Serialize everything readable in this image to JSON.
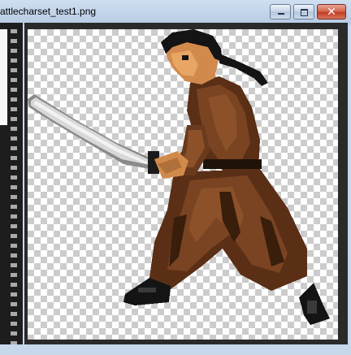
{
  "window": {
    "title": "attlecharset_test1.png",
    "controls": {
      "minimize_label": "",
      "maximize_label": "",
      "close_label": "✕"
    }
  },
  "colors": {
    "skin": "#d28a4c",
    "robe": "#6a3a1c",
    "robe_dark": "#3a1e0c",
    "hair": "#141414",
    "blade": "#cfcfcf",
    "hilt": "#2a2a2a"
  },
  "image": {
    "subject_icon": "samurai-sprite-icon"
  }
}
